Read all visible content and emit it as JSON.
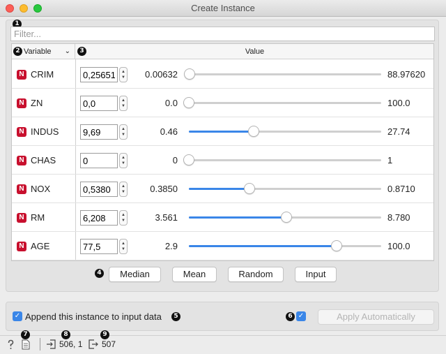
{
  "window": {
    "title": "Create Instance"
  },
  "filter": {
    "placeholder": "Filter..."
  },
  "table": {
    "variable_header": "Variable",
    "value_header": "Value",
    "rows": [
      {
        "name": "CRIM",
        "type_letter": "N",
        "value": "0,25651",
        "min": "0.00632",
        "max": "88.97620",
        "slider_fraction": 0.003
      },
      {
        "name": "ZN",
        "type_letter": "N",
        "value": "0,0",
        "min": "0.0",
        "max": "100.0",
        "slider_fraction": 0.0
      },
      {
        "name": "INDUS",
        "type_letter": "N",
        "value": "9,69",
        "min": "0.46",
        "max": "27.74",
        "slider_fraction": 0.338
      },
      {
        "name": "CHAS",
        "type_letter": "N",
        "value": "0",
        "min": "0",
        "max": "1",
        "slider_fraction": 0.0
      },
      {
        "name": "NOX",
        "type_letter": "N",
        "value": "0,5380",
        "min": "0.3850",
        "max": "0.8710",
        "slider_fraction": 0.315
      },
      {
        "name": "RM",
        "type_letter": "N",
        "value": "6,208",
        "min": "3.561",
        "max": "8.780",
        "slider_fraction": 0.507
      },
      {
        "name": "AGE",
        "type_letter": "N",
        "value": "77,5",
        "min": "2.9",
        "max": "100.0",
        "slider_fraction": 0.768
      }
    ]
  },
  "buttons": {
    "median": "Median",
    "mean": "Mean",
    "random": "Random",
    "input": "Input"
  },
  "append": {
    "label": "Append this instance to input data",
    "checked": true
  },
  "apply": {
    "label": "Apply Automatically",
    "auto_checked": true,
    "enabled": false
  },
  "statusbar": {
    "input_count": "506, 1",
    "output_count": "507"
  },
  "badges": [
    "1",
    "2",
    "3",
    "4",
    "5",
    "6",
    "7",
    "8",
    "9"
  ],
  "colors": {
    "accent": "#3a86e8",
    "numeric_badge": "#c8102e"
  }
}
